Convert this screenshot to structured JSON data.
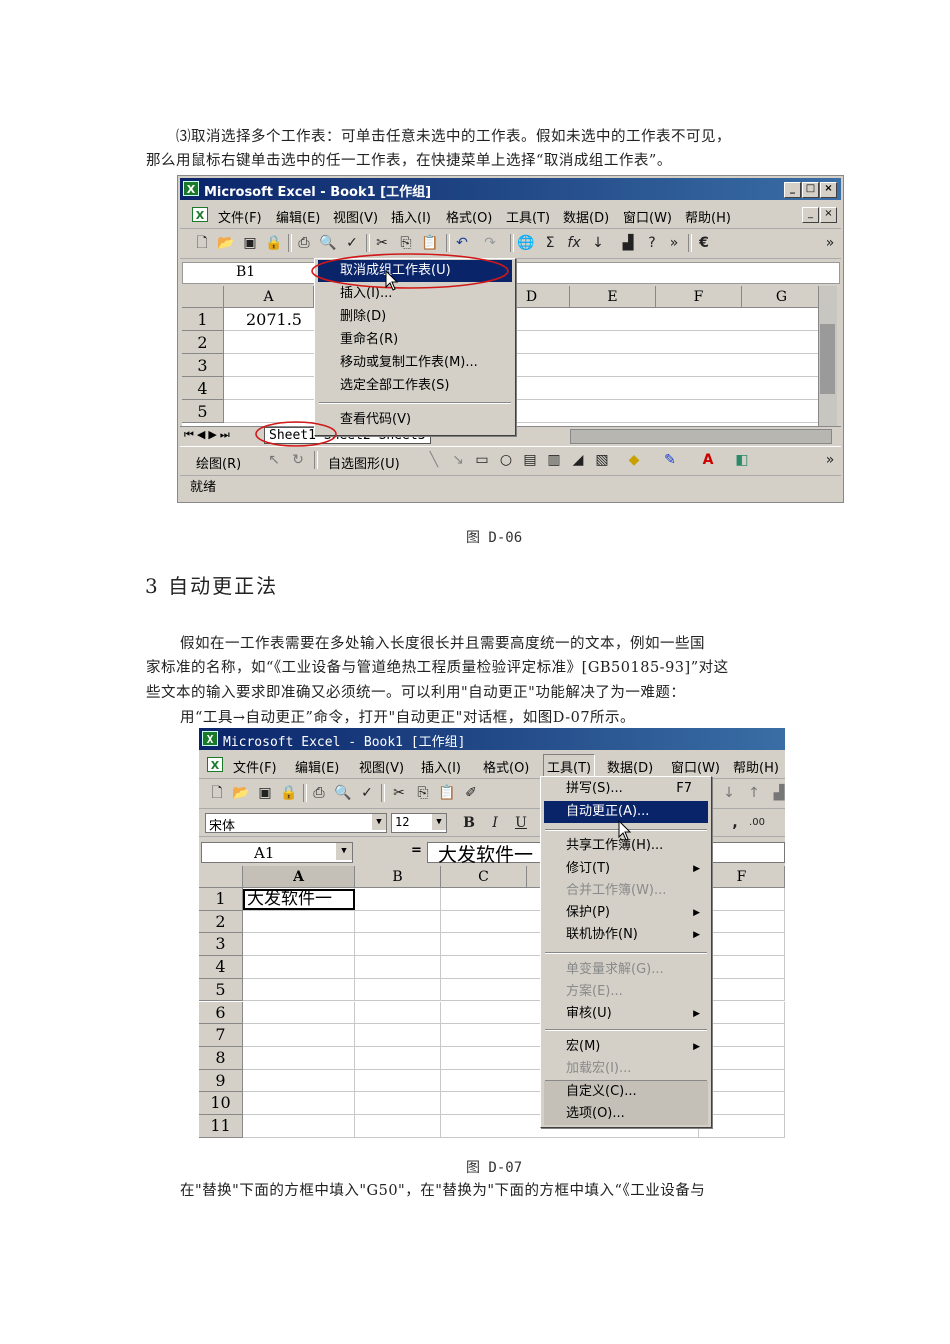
{
  "intro": {
    "line1": "⑶取消选择多个工作表：可单击任意未选中的工作表。假如未选中的工作表不可见，",
    "line2": "那么用鼠标右键单击选中的任一工作表，在快捷菜单上选择“取消成组工作表”。"
  },
  "fig1": {
    "app_title": "Microsoft Excel - Book1 [工作组]",
    "menu": [
      "文件(F)",
      "编辑(E)",
      "视图(V)",
      "插入(I)",
      "格式(O)",
      "工具(T)",
      "数据(D)",
      "窗口(W)",
      "帮助(H)"
    ],
    "name_box": "B1",
    "columns": [
      "A",
      "D",
      "E",
      "F",
      "G"
    ],
    "rows": [
      "1",
      "2",
      "3",
      "4",
      "5"
    ],
    "cell_a1": "2071.5",
    "context_menu": [
      "取消成组工作表(U)",
      "插入(I)...",
      "删除(D)",
      "重命名(R)",
      "移动或复制工作表(M)...",
      "选定全部工作表(S)",
      "查看代码(V)"
    ],
    "sheet_tabs": "Sheet1 Sheet2 Sheet3",
    "draw_label": "绘图(R)",
    "autoshape_label": "自选图形(U)",
    "status": "就绪",
    "caption": "图 D-06"
  },
  "section": {
    "heading": "3 自动更正法",
    "para1": "假如在一工作表需要在多处输入长度很长并且需要高度统一的文本，例如一些国",
    "para2": "家标准的名称，如“《工业设备与管道绝热工程质量检验评定标准》[GB50185-93]”对这",
    "para3": "些文本的输入要求即准确又必须统一。可以利用\"自动更正\"功能解决了为一难题：",
    "para4": "用“工具→自动更正”命令，打开\"自动更正\"对话框，如图D-07所示。"
  },
  "fig2": {
    "app_title": "Microsoft Excel - Book1  [工作组]",
    "menu": [
      "文件(F)",
      "编辑(E)",
      "视图(V)",
      "插入(I)",
      "格式(O)",
      "工具(T)",
      "数据(D)",
      "窗口(W)",
      "帮助(H)"
    ],
    "font_name": "宋体",
    "font_size": "12",
    "name_box": "A1",
    "formula_eq": "=",
    "formula_value": "大发软件一",
    "columns": [
      "A",
      "B",
      "C",
      "F"
    ],
    "rows": [
      "1",
      "2",
      "3",
      "4",
      "5",
      "6",
      "7",
      "8",
      "9",
      "10",
      "11"
    ],
    "cell_a1": "大发软件一",
    "tools_menu": [
      {
        "label": "拼写(S)...",
        "key": "F7"
      },
      {
        "label": "自动更正(A)..."
      },
      {
        "label": "共享工作簿(H)..."
      },
      {
        "label": "修订(T)"
      },
      {
        "label": "合并工作簿(W)..."
      },
      {
        "label": "保护(P)"
      },
      {
        "label": "联机协作(N)"
      },
      {
        "label": "单变量求解(G)..."
      },
      {
        "label": "方案(E)..."
      },
      {
        "label": "审核(U)"
      },
      {
        "label": "宏(M)"
      },
      {
        "label": "加载宏(I)..."
      },
      {
        "label": "自定义(C)..."
      },
      {
        "label": "选项(O)..."
      }
    ],
    "caption": "图 D-07"
  },
  "footer_line": "在\"替换\"下面的方框中填入\"G50\"，在\"替换为\"下面的方框中填入“《工业设备与"
}
